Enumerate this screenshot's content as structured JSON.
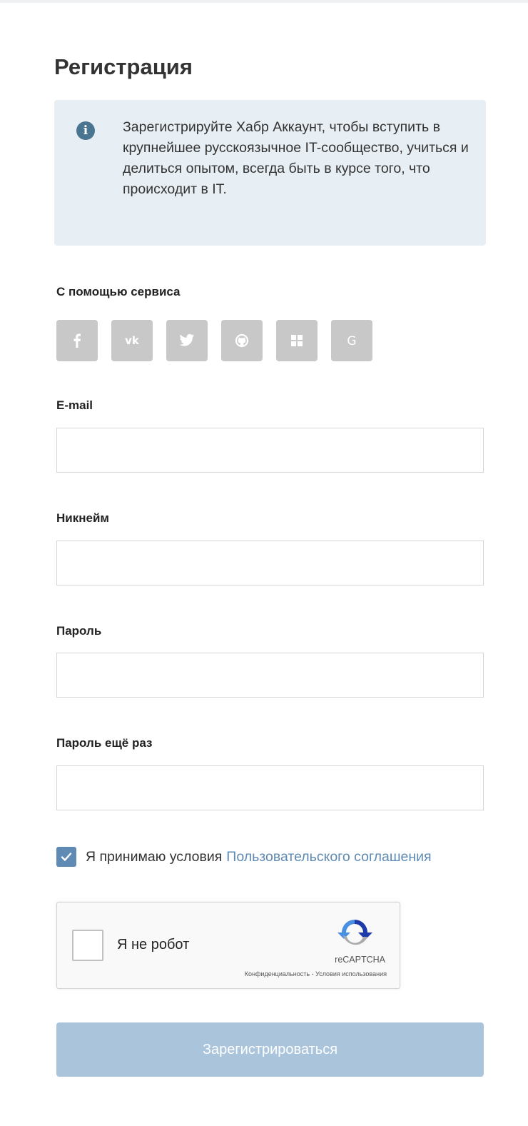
{
  "page": {
    "title": "Регистрация"
  },
  "info": {
    "icon": "info-icon",
    "text": "Зарегистрируйте Хабр Аккаунт, чтобы вступить в крупнейшее русскоязычное IT-сообщество, учиться и делиться опытом, всегда быть в курсе того, что происходит в IT."
  },
  "social": {
    "label": "С помощью сервиса",
    "providers": [
      {
        "name": "facebook",
        "icon": "facebook-icon"
      },
      {
        "name": "vk",
        "icon": "vk-icon"
      },
      {
        "name": "twitter",
        "icon": "twitter-icon"
      },
      {
        "name": "github",
        "icon": "github-icon"
      },
      {
        "name": "live",
        "icon": "microsoft-icon"
      },
      {
        "name": "google",
        "icon": "google-icon"
      }
    ]
  },
  "form": {
    "email": {
      "label": "E-mail",
      "value": "",
      "placeholder": ""
    },
    "nickname": {
      "label": "Никнейм",
      "value": "",
      "placeholder": ""
    },
    "password": {
      "label": "Пароль",
      "value": "",
      "placeholder": ""
    },
    "password_repeat": {
      "label": "Пароль ещё раз",
      "value": "",
      "placeholder": ""
    },
    "agreement": {
      "checked": true,
      "text": "Я принимаю условия",
      "link_text": "Пользовательского соглашения"
    },
    "submit_label": "Зарегистрироваться"
  },
  "recaptcha": {
    "label": "Я не робот",
    "brand": "reCAPTCHA",
    "privacy": "Конфиденциальность",
    "separator": " - ",
    "terms": "Условия использования"
  },
  "colors": {
    "info_bg": "#e8eff4",
    "info_icon": "#4a7591",
    "social_btn": "#c8c8c8",
    "link": "#5e8ab3",
    "checkbox": "#5e8ab3",
    "submit_disabled": "#aac4dc"
  }
}
